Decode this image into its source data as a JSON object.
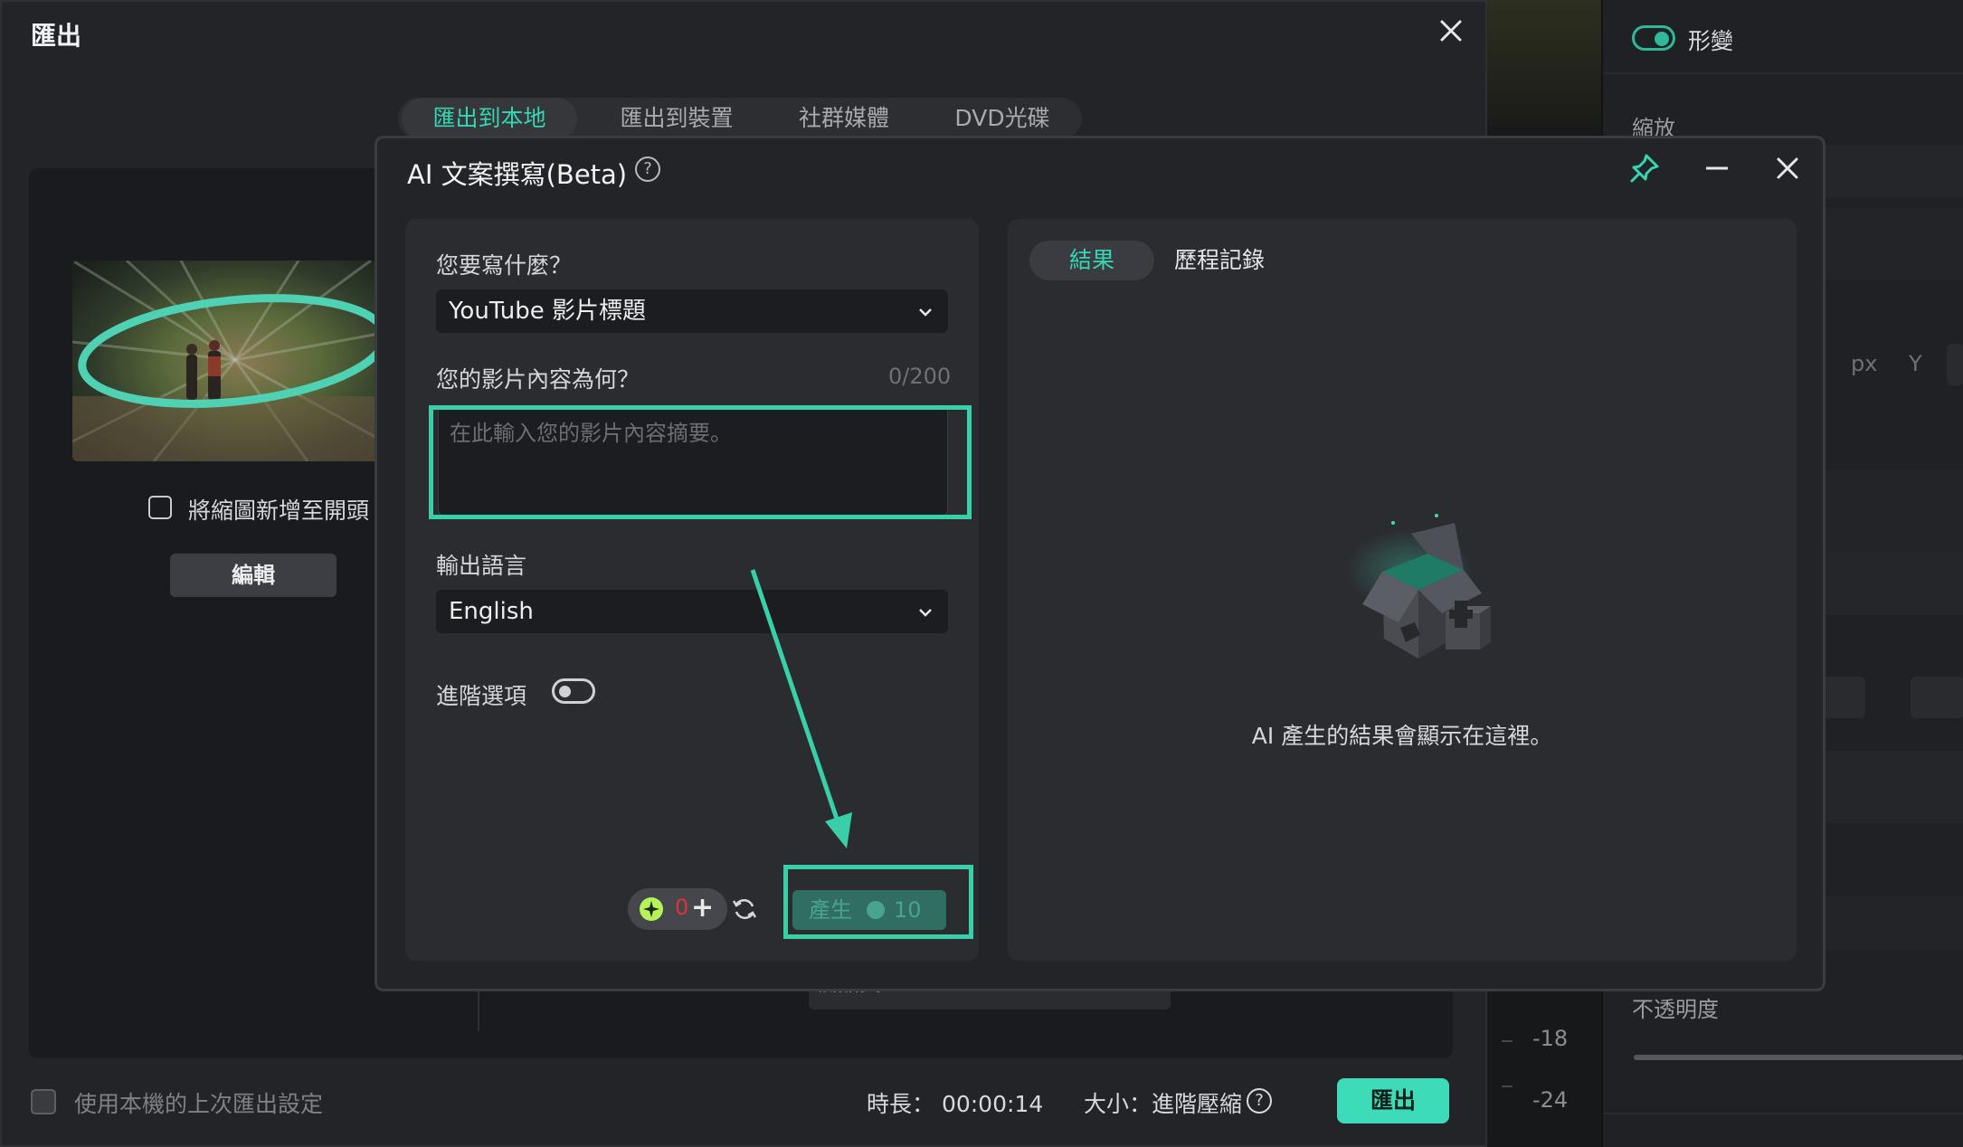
{
  "editor": {
    "morph_label": "形變",
    "scale_label": "縮放",
    "unit_px": "px",
    "axis_y": "Y",
    "opacity_label": "不透明度",
    "ruler": [
      "-18",
      "-24"
    ]
  },
  "export": {
    "title": "匯出",
    "tabs": [
      "匯出到本地",
      "匯出到裝置",
      "社群媒體",
      "DVD光碟"
    ],
    "active_tab": 0,
    "thumbnail_checkbox_label": "將縮圖新增至開頭",
    "edit_button": "編輯",
    "quality_peek": "低品質",
    "use_last_settings": "使用本機的上次匯出設定",
    "duration": "時長： 00:00:14",
    "size": "大小：進階壓縮",
    "help_glyph": "?",
    "export_button": "匯出"
  },
  "ai": {
    "title": "AI 文案撰寫(Beta)",
    "help_glyph": "?",
    "what_label": "您要寫什麼？",
    "what_value": "YouTube 影片標題",
    "content_label": "您的影片內容為何？",
    "char_count": "0/200",
    "content_placeholder": "在此輸入您的影片內容摘要。",
    "content_value": "",
    "lang_label": "輸出語言",
    "lang_value": "English",
    "advanced_label": "進階選項",
    "advanced_enabled": false,
    "credits": "0",
    "generate_label": "產生",
    "generate_cost": "10",
    "result_tab": "結果",
    "history_tab": "歷程記錄",
    "empty_text": "AI 產生的結果會顯示在這裡。"
  },
  "colors": {
    "accent": "#35d6b3",
    "highlight": "#38cfa9",
    "panel": "#2b2c30",
    "dialog": "#232427",
    "credit_zero": "#e0323a"
  }
}
